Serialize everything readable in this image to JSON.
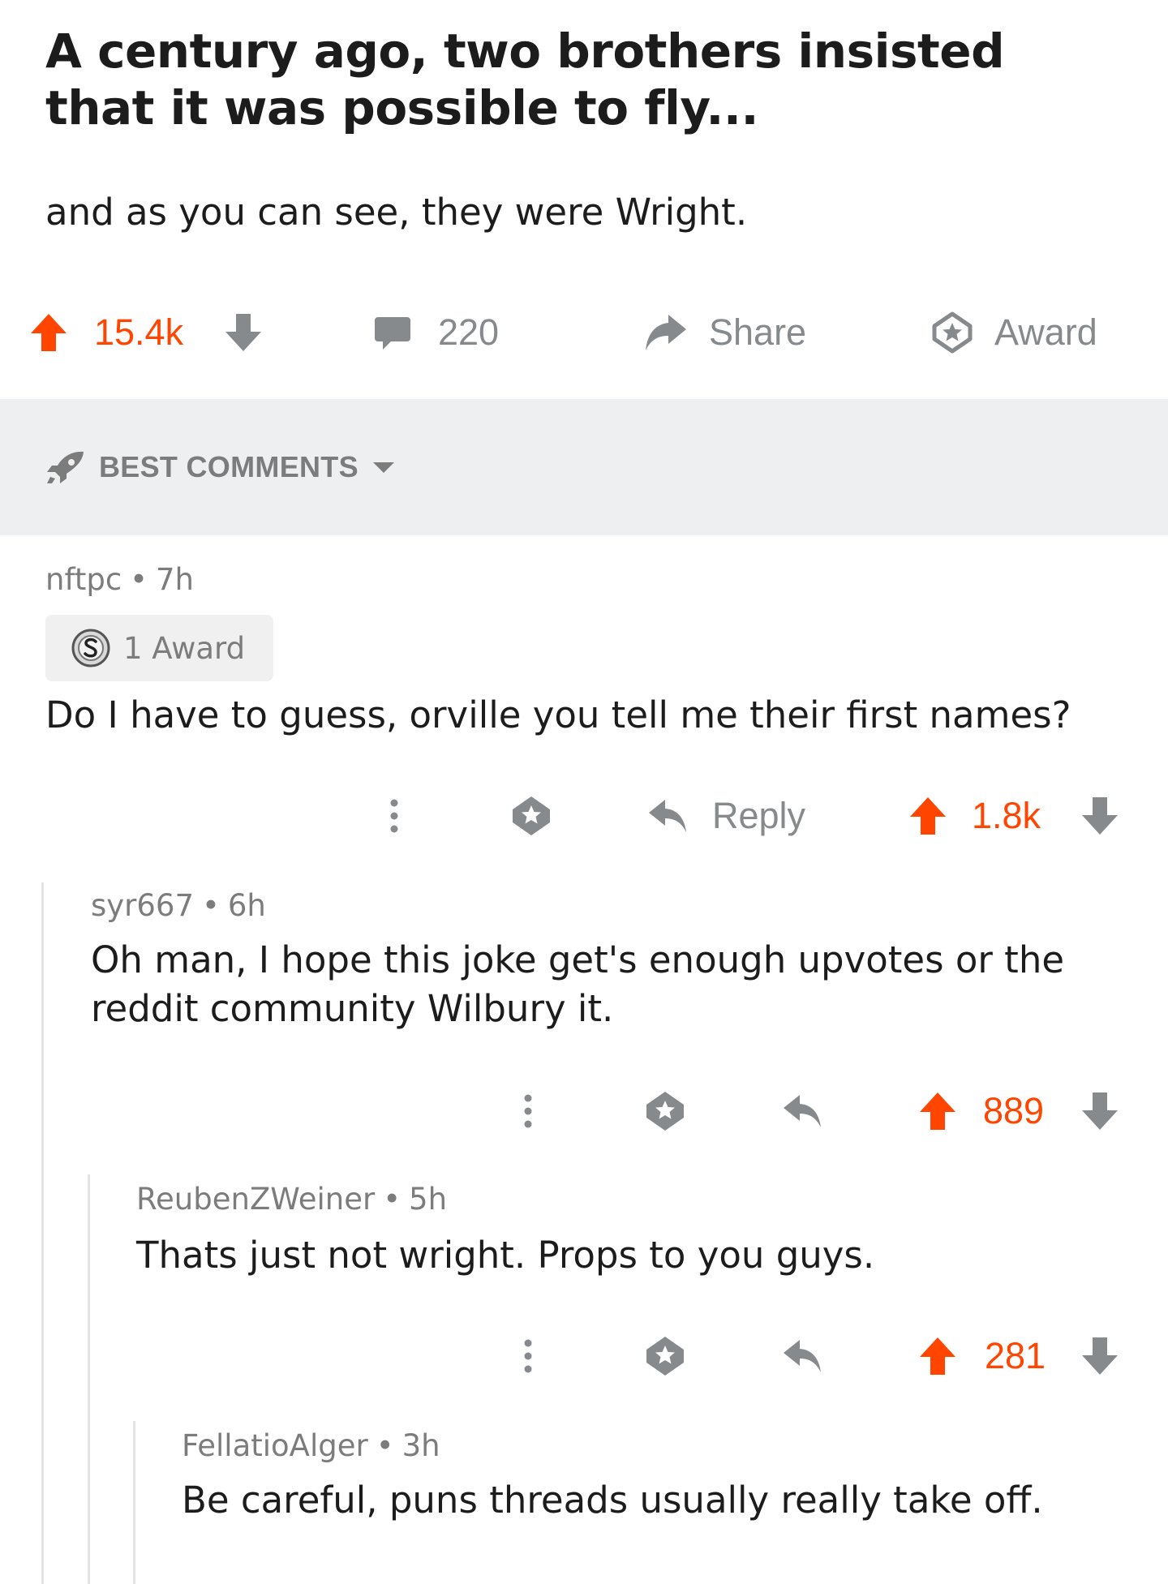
{
  "post": {
    "title": "A century ago, two brothers insisted that it was possible to fly...",
    "body": "and as you can see, they were Wright.",
    "score": "15.4k",
    "comments_count": "220",
    "share_label": "Share",
    "award_label": "Award"
  },
  "sort": {
    "label": "BEST COMMENTS"
  },
  "comments": [
    {
      "author": "nftpc",
      "time": "7h",
      "award_text": "1 Award",
      "text": "Do I have to guess, orville you tell me their first names?",
      "reply_label": "Reply",
      "score": "1.8k"
    },
    {
      "author": "syr667",
      "time": "6h",
      "text": "Oh man, I hope this joke get's enough upvotes or the reddit community Wilbury it.",
      "score": "889"
    },
    {
      "author": "ReubenZWeiner",
      "time": "5h",
      "text": "Thats just not wright. Props to you guys.",
      "score": "281"
    },
    {
      "author": "FellatioAlger",
      "time": "3h",
      "text": "Be careful, puns threads usually really take off."
    }
  ],
  "icons": {
    "upvote": "upvote-arrow-icon",
    "downvote": "downvote-arrow-icon",
    "comment": "speech-bubble-icon",
    "share": "share-arrow-icon",
    "award": "award-star-icon",
    "sort": "rocket-icon",
    "more": "vertical-dots-icon",
    "reply": "reply-arrow-icon",
    "silver_award": "silver-award-icon"
  },
  "colors": {
    "accent": "#ff4500",
    "muted": "#878a8c",
    "sort_bar_bg": "#edeff1"
  }
}
